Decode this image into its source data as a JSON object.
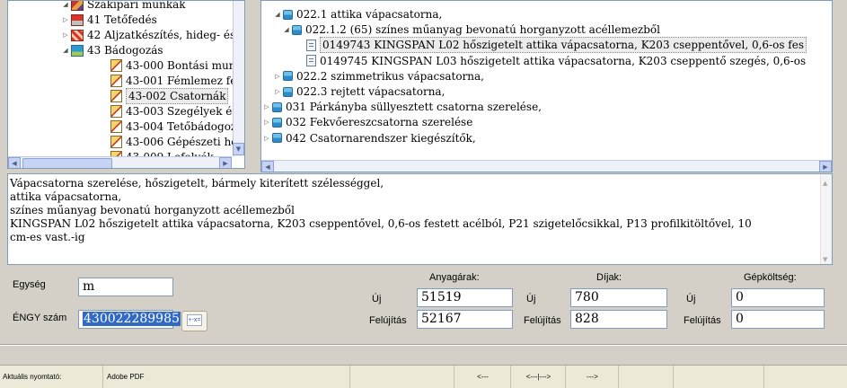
{
  "left_tree": {
    "items": [
      {
        "label": "Szakipari munkák",
        "icon": "trades-icon",
        "twisty": "expanded"
      },
      {
        "label": "41 Tetőfedés",
        "icon": "roof-icon",
        "twisty": "collapsed"
      },
      {
        "label": "42 Aljzatkészítés, hideg- és m",
        "icon": "checker-icon",
        "twisty": "collapsed"
      },
      {
        "label": "43 Bádogozás",
        "icon": "tin-icon",
        "twisty": "expanded"
      },
      {
        "label": "43-000 Bontási munkák",
        "icon": "item-icon"
      },
      {
        "label": "43-001 Fémlemez fedése",
        "icon": "item-icon"
      },
      {
        "label": "43-002 Csatornák",
        "icon": "item-icon",
        "selected": true
      },
      {
        "label": "43-003 Szegélyek és hajla",
        "icon": "item-icon"
      },
      {
        "label": "43-004 Tetőbádogozások",
        "icon": "item-icon"
      },
      {
        "label": "43-006 Gépészeti hőszig",
        "icon": "item-icon"
      },
      {
        "label": "43-009 Lefolyók",
        "icon": "item-icon"
      }
    ]
  },
  "right_tree": {
    "items": [
      {
        "label": "022.1 attika vápacsatorna,",
        "icon": "folder-icon",
        "twisty": "expanded"
      },
      {
        "label": "022.1.2 (65) színes műanyag bevonatú horganyzott acéllemezből",
        "icon": "folder-icon",
        "twisty": "expanded"
      },
      {
        "label": "0149743 KINGSPAN L02 hőszigetelt attika vápacsatorna, K203 cseppentővel, 0,6-os fes",
        "icon": "doc-icon",
        "selected": true
      },
      {
        "label": "0149745 KINGSPAN L03 hőszigetelt attika vápacsatorna, K203 cseppentő szegés, 0,6-os",
        "icon": "doc-icon"
      },
      {
        "label": "022.2 szimmetrikus vápacsatorna,",
        "icon": "folder-icon",
        "twisty": "collapsed"
      },
      {
        "label": "022.3 rejtett vápacsatorna,",
        "icon": "folder-icon",
        "twisty": "collapsed"
      },
      {
        "label": "031 Párkányba süllyesztett csatorna szerelése,",
        "icon": "folder-icon",
        "twisty": "collapsed"
      },
      {
        "label": "032 Fekvőereszcsatorna szerelése",
        "icon": "folder-icon",
        "twisty": "collapsed"
      },
      {
        "label": "042 Csatornarendszer kiegészítők,",
        "icon": "folder-icon",
        "twisty": "collapsed"
      }
    ]
  },
  "description": {
    "text": "Vápacsatorna szerelése, hőszigetelt, bármely kiterített szélességgel,\nattika vápacsatorna,\nszínes műanyag bevonatú horganyzott acéllemezből\nKINGSPAN L02 hőszigetelt attika vápacsatorna, K203 cseppentővel, 0,6-os festett acélból, P21 szigetelőcsikkal, P13 profilkitöltővel, 10\ncm-es vast.-ig"
  },
  "form": {
    "unit_label": "Egység",
    "unit_value": "m",
    "engy_label": "ÉNGY szám",
    "engy_value": "430022289985",
    "calc_button": "+-x=",
    "material_header": "Anyagárak:",
    "fee_header": "Díjak:",
    "machine_header": "Gépköltség:",
    "new_label": "Új",
    "renovation_label": "Felújítás",
    "material_new": "51519",
    "material_renovation": "52167",
    "fee_new": "780",
    "fee_renovation": "828",
    "machine_new": "0",
    "machine_renovation": "0"
  },
  "status_bar": {
    "printer_label": "Aktuális nyomtató:",
    "printer_value": "Adobe PDF",
    "nav_back": "<---",
    "nav_both": "<---|--->",
    "nav_forward": "--->"
  }
}
